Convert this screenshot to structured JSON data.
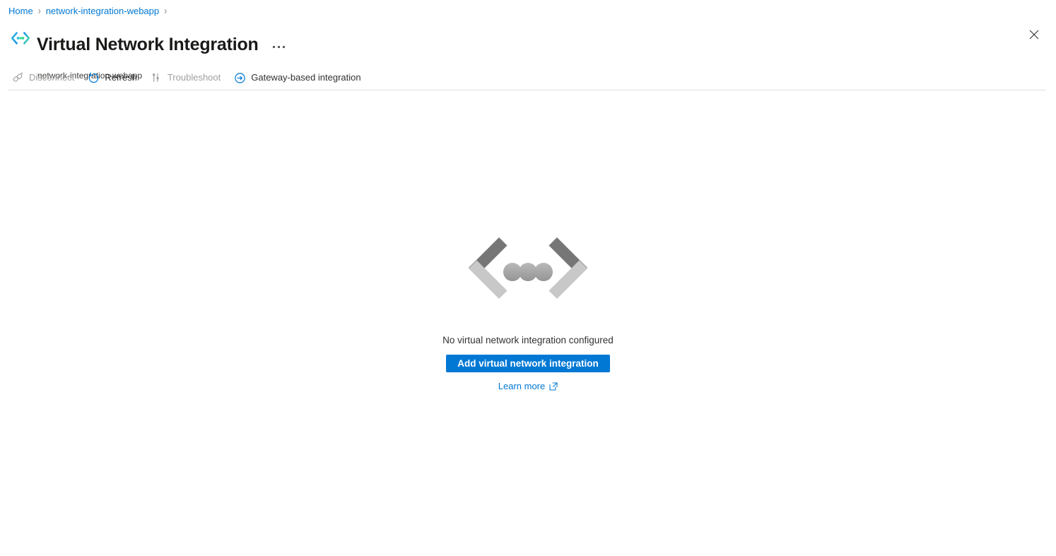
{
  "breadcrumb": {
    "items": [
      {
        "label": "Home"
      },
      {
        "label": "network-integration-webapp"
      }
    ],
    "separator": "›"
  },
  "header": {
    "title": "Virtual Network Integration",
    "subtitle": "network-integration-webapp",
    "icon": "code-brackets-icon",
    "more_options_label": "...",
    "close_label": "✕",
    "accent_color": "#0078d4"
  },
  "commandbar": {
    "items": [
      {
        "label": "Disconnect",
        "icon": "disconnect-icon",
        "enabled": false
      },
      {
        "label": "Refresh",
        "icon": "refresh-icon",
        "enabled": true
      },
      {
        "label": "Troubleshoot",
        "icon": "troubleshoot-icon",
        "enabled": false
      },
      {
        "label": "Gateway-based integration",
        "icon": "arrow-right-circle-icon",
        "enabled": true
      }
    ]
  },
  "empty_state": {
    "illustration": "code-brackets-dots-illustration",
    "message": "No virtual network integration configured",
    "primary_button": "Add virtual network integration",
    "learn_more": "Learn more",
    "learn_more_icon": "external-link-icon",
    "button_color": "#0078d4",
    "illustration_colors": {
      "dark": "#767676",
      "light": "#c8c8c8",
      "dot": "#a6a6a6"
    }
  }
}
